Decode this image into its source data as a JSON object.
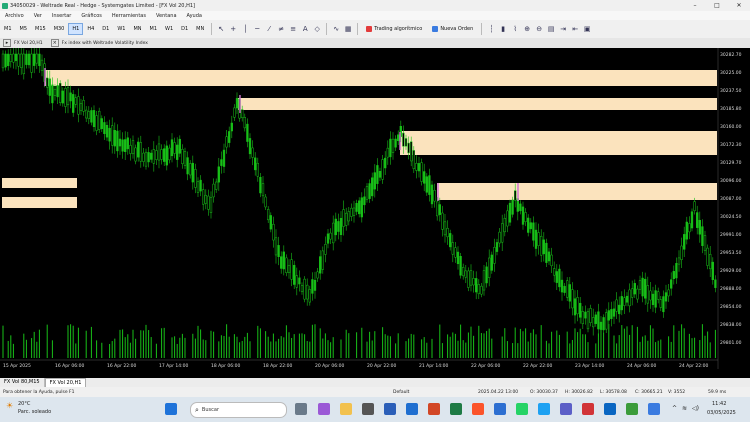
{
  "window": {
    "title": "34050029 - Weltrade Real - Hedge - Systemgates Limited - [FX Vol 20,H1]",
    "controls": [
      "–",
      "□",
      "✕"
    ]
  },
  "menu": [
    "Archivo",
    "Ver",
    "Insertar",
    "Gráficos",
    "Herramientas",
    "Ventana",
    "Ayuda"
  ],
  "toolbar": {
    "timeframes": [
      "M1",
      "M5",
      "M15",
      "M30",
      "H1",
      "H4",
      "D1",
      "W1",
      "MN",
      "M1",
      "W1",
      "D1",
      "MN"
    ],
    "active_timeframe": "H1",
    "algo_button": "Trading algorítmico",
    "new_order_button": "Nueva Orden"
  },
  "chart_header": {
    "symbol": "FX Vol 20,H1",
    "indicator": "Fx index with Weltrade Volatility Index"
  },
  "chart": {
    "price_labels": [
      "30282.70",
      "30225.00",
      "30237.50",
      "30185.80",
      "30160.00",
      "30172.30",
      "30129.70",
      "30096.00",
      "30087.00",
      "30024.50",
      "29991.00",
      "29953.50",
      "29929.00",
      "29888.00",
      "29854.00",
      "29838.00",
      "29801.00"
    ],
    "time_labels": [
      "15 Apr 2025",
      "16 Apr 06:00",
      "16 Apr 22:00",
      "17 Apr 14:00",
      "18 Apr 06:00",
      "18 Apr 22:00",
      "20 Apr 06:00",
      "20 Apr 22:00",
      "21 Apr 14:00",
      "22 Apr 06:00",
      "22 Apr 22:00",
      "23 Apr 14:00",
      "24 Apr 06:00",
      "24 Apr 22:00"
    ],
    "candle_color": "#18c018",
    "zone_color": "#fbe3bd"
  },
  "tabs": [
    "FX Vol 80,M15",
    "FX Vol 20,H1"
  ],
  "active_tab": "FX Vol 20,H1",
  "status": {
    "help": "Para obtener la Ayuda, pulse F1",
    "profile": "Default",
    "datetime": "2025.04.22 13:00",
    "open": "O: 30030.37",
    "high": "H: 30026.82",
    "low": "L: 30578.08",
    "close": "C: 30665.21",
    "volume": "V: 3552",
    "ping": "59.9 ms"
  },
  "taskbar": {
    "weather_temp": "20°C",
    "weather_desc": "Parc. soleado",
    "search_placeholder": "Buscar",
    "time": "11:42",
    "date": "03/05/2025"
  }
}
